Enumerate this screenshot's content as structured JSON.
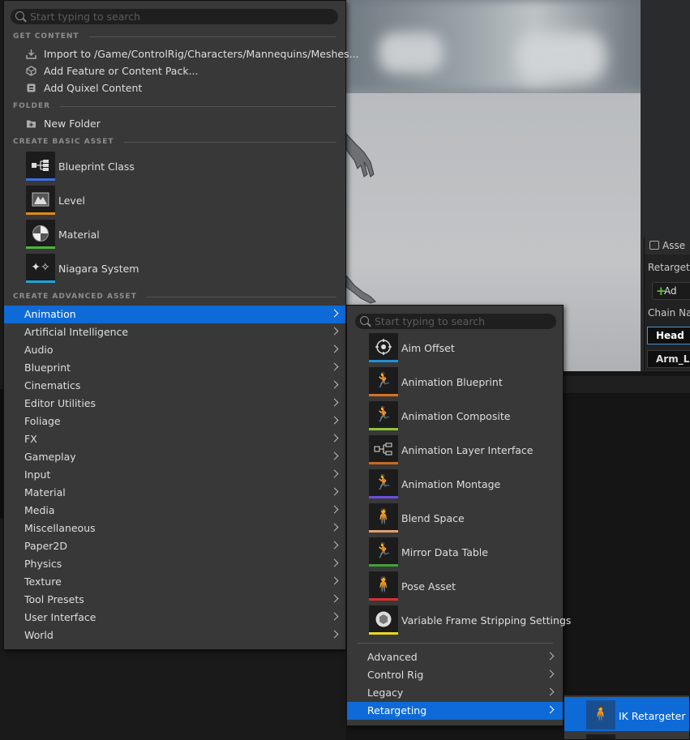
{
  "main_menu": {
    "search_placeholder": "Start typing to search",
    "sections": {
      "get_content": "GET CONTENT",
      "folder": "FOLDER",
      "create_basic": "CREATE BASIC ASSET",
      "create_advanced": "CREATE ADVANCED ASSET"
    },
    "get_content_items": [
      {
        "label": "Import to /Game/ControlRig/Characters/Mannequins/Meshes...",
        "icon": "import-icon"
      },
      {
        "label": "Add Feature or Content Pack...",
        "icon": "content-pack-icon"
      },
      {
        "label": "Add Quixel Content",
        "icon": "quixel-icon"
      }
    ],
    "folder_items": [
      {
        "label": "New Folder",
        "icon": "new-folder-icon"
      }
    ],
    "basic_assets": [
      {
        "label": "Blueprint Class",
        "icon": "blueprint-class-icon",
        "color": "#3b6fe0"
      },
      {
        "label": "Level",
        "icon": "level-icon",
        "color": "#e08a1e"
      },
      {
        "label": "Material",
        "icon": "material-icon",
        "color": "#4fb33c"
      },
      {
        "label": "Niagara System",
        "icon": "niagara-system-icon",
        "color": "#1fa3d8"
      }
    ],
    "categories": [
      "Animation",
      "Artificial Intelligence",
      "Audio",
      "Blueprint",
      "Cinematics",
      "Editor Utilities",
      "Foliage",
      "FX",
      "Gameplay",
      "Input",
      "Material",
      "Media",
      "Miscellaneous",
      "Paper2D",
      "Physics",
      "Texture",
      "Tool Presets",
      "User Interface",
      "World"
    ]
  },
  "animation_menu": {
    "search_placeholder": "Start typing to search",
    "items": [
      {
        "label": "Aim Offset",
        "icon": "aim-offset-icon",
        "color": "#1f8fd8"
      },
      {
        "label": "Animation Blueprint",
        "icon": "animation-blueprint-icon",
        "color": "#d8731f"
      },
      {
        "label": "Animation Composite",
        "icon": "animation-composite-icon",
        "color": "#8fc43a"
      },
      {
        "label": "Animation Layer Interface",
        "icon": "animation-layer-interface-icon",
        "color": "#c86a1f"
      },
      {
        "label": "Animation Montage",
        "icon": "animation-montage-icon",
        "color": "#6b4ed8"
      },
      {
        "label": "Blend Space",
        "icon": "blend-space-icon",
        "color": "#e0a070"
      },
      {
        "label": "Mirror Data Table",
        "icon": "mirror-data-table-icon",
        "color": "#3fa33c"
      },
      {
        "label": "Pose Asset",
        "icon": "pose-asset-icon",
        "color": "#d83030"
      },
      {
        "label": "Variable Frame Stripping Settings",
        "icon": "variable-frame-stripping-icon",
        "color": "#e8d820"
      }
    ],
    "subcategories": [
      "Advanced",
      "Control Rig",
      "Legacy",
      "Retargeting"
    ]
  },
  "retargeting_menu": {
    "items": [
      {
        "label": "IK Retargeter",
        "icon": "ik-retargeter-icon"
      }
    ]
  },
  "details_panel": {
    "tab_label": "Asse",
    "retarget_label": "Retarget",
    "add_button": "Ad",
    "chain_label": "Chain Na",
    "chains": [
      "Head",
      "Arm_L"
    ]
  },
  "colors": {
    "selection": "#0e6ad6",
    "menu_bg": "#383838"
  }
}
